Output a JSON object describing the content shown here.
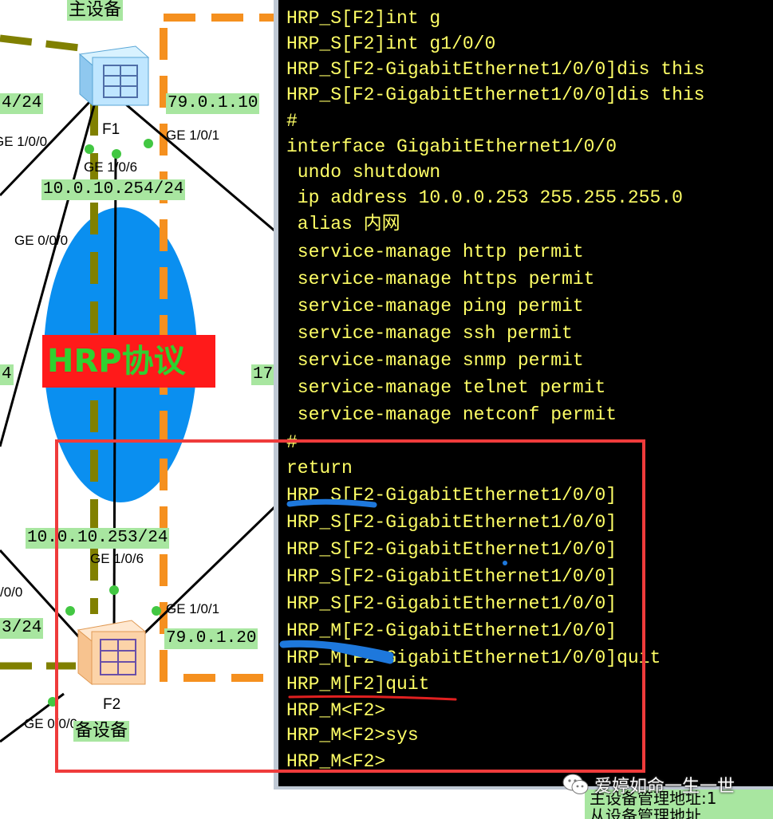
{
  "topology": {
    "master_label": "主设备",
    "backup_label": "备设备",
    "hrp_label": "HRP协议",
    "f1": {
      "name": "F1",
      "addr_top": "79.0.1.10",
      "addr_left": "4/24",
      "addr_inner": "10.0.10.254/24",
      "port_left": "GE 1/0/0",
      "port_right": "GE 1/0/1",
      "port_down": "GE 1/0/6",
      "port_ge000": "GE 0/0/0"
    },
    "f2": {
      "name": "F2",
      "addr_right": "79.0.1.20",
      "addr_left": "3/24",
      "addr_inner": "10.0.10.253/24",
      "port_up": "GE 1/0/6",
      "port_right": "GE 1/0/1",
      "port_left": "/0/0",
      "port_ge000": "GE 0/0/0"
    },
    "side_label_left": "4",
    "side_label_right": "17"
  },
  "terminal": {
    "lines": [
      "HRP_S[F2]int g",
      "HRP_S[F2]int g1/0/0",
      "HRP_S[F2-GigabitEthernet1/0/0]dis this",
      "HRP_S[F2-GigabitEthernet1/0/0]dis this",
      "#",
      "interface GigabitEthernet1/0/0",
      " undo shutdown",
      " ip address 10.0.0.253 255.255.255.0",
      " alias 内网",
      " service-manage http permit",
      " service-manage https permit",
      " service-manage ping permit",
      " service-manage ssh permit",
      " service-manage snmp permit",
      " service-manage telnet permit",
      " service-manage netconf permit",
      "#",
      "return",
      "HRP_S[F2-GigabitEthernet1/0/0]",
      "HRP_S[F2-GigabitEthernet1/0/0]",
      "HRP_S[F2-GigabitEthernet1/0/0]",
      "HRP_S[F2-GigabitEthernet1/0/0]",
      "HRP_S[F2-GigabitEthernet1/0/0]",
      "HRP_M[F2-GigabitEthernet1/0/0]",
      "HRP_M[F2-GigabitEthernet1/0/0]quit",
      "HRP_M[F2]quit",
      "HRP_M<F2>",
      "HRP_M<F2>sys",
      "HRP_M<F2>"
    ]
  },
  "watermark": {
    "text": "爱婷如命一生一世"
  },
  "bottom_strip": {
    "line1": "主设备管理地址:1",
    "line2": "从设备管理地址"
  },
  "colors": {
    "terminal_text": "#ffff66",
    "terminal_bg": "#000000",
    "label_bg": "#a8e6a0",
    "highlight": "#ef3b3b",
    "underline_blue": "#1e78dc",
    "underline_red": "#e02020"
  }
}
